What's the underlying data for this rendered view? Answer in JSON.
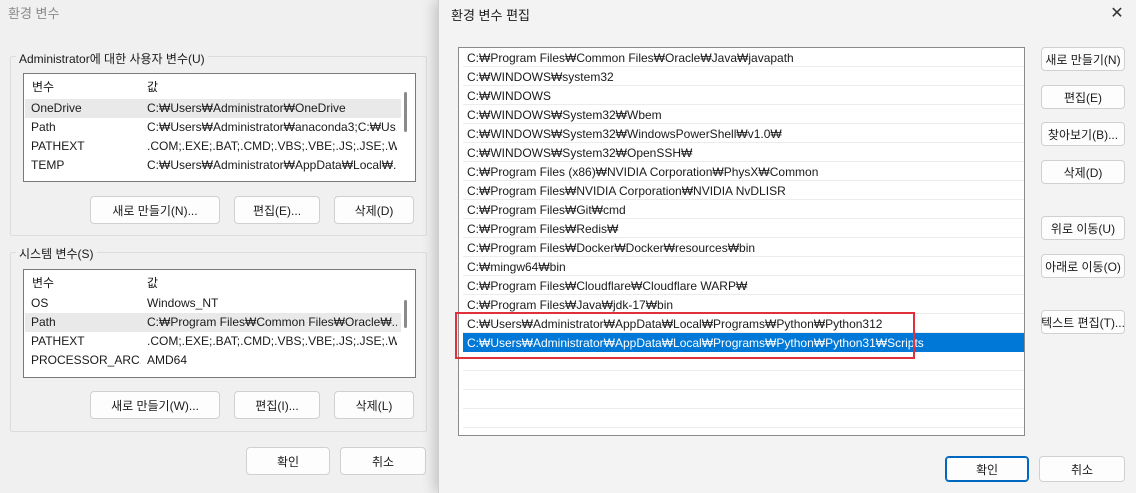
{
  "bg": {
    "title": "환경 변수",
    "user_group": {
      "label": "Administrator에 대한 사용자 변수(U)",
      "headers": [
        "변수",
        "값"
      ],
      "rows": [
        {
          "name": "OneDrive",
          "value": "C:₩Users₩Administrator₩OneDrive"
        },
        {
          "name": "Path",
          "value": "C:₩Users₩Administrator₩anaconda3;C:₩Us..."
        },
        {
          "name": "PATHEXT",
          "value": ".COM;.EXE;.BAT;.CMD;.VBS;.VBE;.JS;.JSE;.W..."
        },
        {
          "name": "TEMP",
          "value": "C:₩Users₩Administrator₩AppData₩Local₩..."
        }
      ],
      "buttons": {
        "new": "새로 만들기(N)...",
        "edit": "편집(E)...",
        "delete": "삭제(D)"
      }
    },
    "system_group": {
      "label": "시스템 변수(S)",
      "headers": [
        "변수",
        "값"
      ],
      "rows": [
        {
          "name": "OS",
          "value": "Windows_NT"
        },
        {
          "name": "Path",
          "value": "C:₩Program Files₩Common Files₩Oracle₩..."
        },
        {
          "name": "PATHEXT",
          "value": ".COM;.EXE;.BAT;.CMD;.VBS;.VBE;.JS;.JSE;.W..."
        },
        {
          "name": "PROCESSOR_ARC...",
          "value": "AMD64"
        }
      ],
      "buttons": {
        "new": "새로 만들기(W)...",
        "edit": "편집(I)...",
        "delete": "삭제(L)"
      }
    },
    "ok": "확인",
    "cancel": "취소"
  },
  "fg": {
    "title": "환경 변수 편집",
    "close_icon": "close-icon",
    "paths": [
      "C:₩Program Files₩Common Files₩Oracle₩Java₩javapath",
      "C:₩WINDOWS₩system32",
      "C:₩WINDOWS",
      "C:₩WINDOWS₩System32₩Wbem",
      "C:₩WINDOWS₩System32₩WindowsPowerShell₩v1.0₩",
      "C:₩WINDOWS₩System32₩OpenSSH₩",
      "C:₩Program Files (x86)₩NVIDIA Corporation₩PhysX₩Common",
      "C:₩Program Files₩NVIDIA Corporation₩NVIDIA NvDLISR",
      "C:₩Program Files₩Git₩cmd",
      "C:₩Program Files₩Redis₩",
      "C:₩Program Files₩Docker₩Docker₩resources₩bin",
      "C:₩mingw64₩bin",
      "C:₩Program Files₩Cloudflare₩Cloudflare WARP₩",
      "C:₩Program Files₩Java₩jdk-17₩bin",
      "C:₩Users₩Administrator₩AppData₩Local₩Programs₩Python₩Python312",
      "C:₩Users₩Administrator₩AppData₩Local₩Programs₩Python₩Python31₩Scripts"
    ],
    "selected_index": 15,
    "buttons": {
      "new": "새로 만들기(N)",
      "edit": "편집(E)",
      "browse": "찾아보기(B)...",
      "delete": "삭제(D)",
      "move_up": "위로 이동(U)",
      "move_down": "아래로 이동(O)",
      "edit_text": "텍스트 편집(T)...",
      "ok": "확인",
      "cancel": "취소"
    },
    "highlight_color": "#e0303a",
    "selection_color": "#0078d7"
  }
}
